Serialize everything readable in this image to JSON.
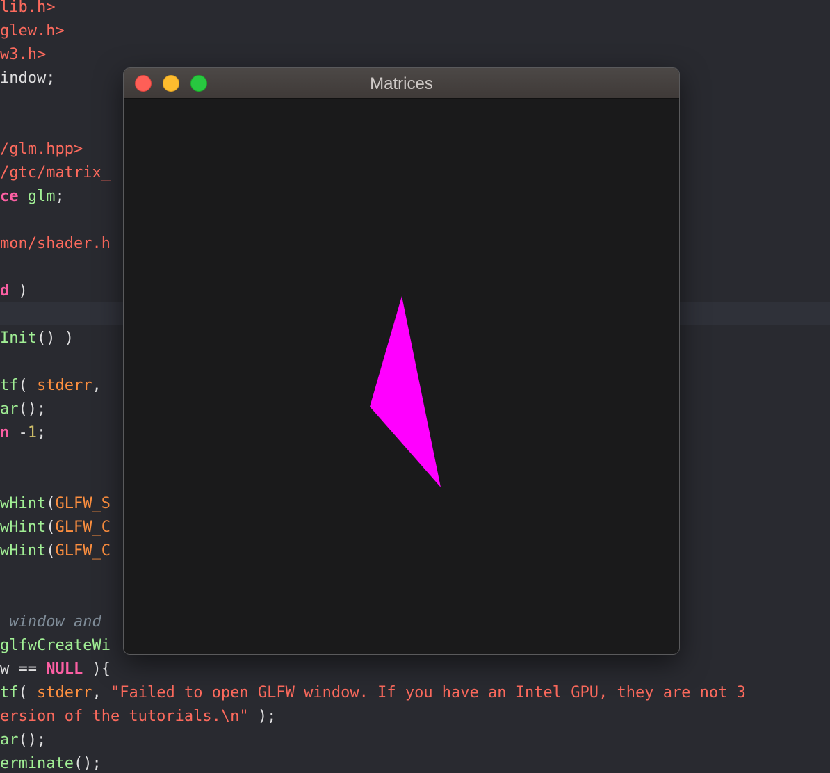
{
  "window": {
    "title": "Matrices"
  },
  "scene": {
    "background": "#1a1a1b",
    "triangle_color": "#ff00ff"
  },
  "editor": {
    "highlight_line": 13,
    "lines": [
      [
        {
          "t": "lib.h>",
          "c": "t-str"
        }
      ],
      [
        {
          "t": "glew.h>",
          "c": "t-str"
        }
      ],
      [
        {
          "t": "w3.h>",
          "c": "t-str"
        }
      ],
      [
        {
          "t": "indow;",
          "c": "t-pln"
        }
      ],
      [],
      [],
      [
        {
          "t": "/glm.hpp>",
          "c": "t-str"
        }
      ],
      [
        {
          "t": "/gtc/matrix_",
          "c": "t-str"
        }
      ],
      [
        {
          "t": "ce",
          "c": "t-kw"
        },
        {
          "t": " ",
          "c": "t-pln"
        },
        {
          "t": "glm",
          "c": "t-fn"
        },
        {
          "t": ";",
          "c": "t-pln"
        }
      ],
      [],
      [
        {
          "t": "mon/shader.h",
          "c": "t-str"
        }
      ],
      [],
      [
        {
          "t": "d",
          "c": "t-kw"
        },
        {
          "t": " )",
          "c": "t-pln"
        }
      ],
      [],
      [
        {
          "t": "Init",
          "c": "t-fn"
        },
        {
          "t": "() )",
          "c": "t-pln"
        }
      ],
      [],
      [
        {
          "t": "tf",
          "c": "t-fn"
        },
        {
          "t": "( ",
          "c": "t-pln"
        },
        {
          "t": "stderr",
          "c": "t-arg"
        },
        {
          "t": ",",
          "c": "t-pln"
        }
      ],
      [
        {
          "t": "ar",
          "c": "t-fn"
        },
        {
          "t": "();",
          "c": "t-pln"
        }
      ],
      [
        {
          "t": "n",
          "c": "t-kw"
        },
        {
          "t": " -",
          "c": "t-pln"
        },
        {
          "t": "1",
          "c": "t-num"
        },
        {
          "t": ";",
          "c": "t-pln"
        }
      ],
      [],
      [],
      [
        {
          "t": "wHint",
          "c": "t-fn"
        },
        {
          "t": "(",
          "c": "t-pln"
        },
        {
          "t": "GLFW_S",
          "c": "t-mac"
        }
      ],
      [
        {
          "t": "wHint",
          "c": "t-fn"
        },
        {
          "t": "(",
          "c": "t-pln"
        },
        {
          "t": "GLFW_C",
          "c": "t-mac"
        }
      ],
      [
        {
          "t": "wHint",
          "c": "t-fn"
        },
        {
          "t": "(",
          "c": "t-pln"
        },
        {
          "t": "GLFW_C",
          "c": "t-mac"
        }
      ],
      [],
      [],
      [
        {
          "t": " window and",
          "c": "t-cmt"
        }
      ],
      [
        {
          "t": "glfwCreateWi",
          "c": "t-fn"
        }
      ],
      [
        {
          "t": "w",
          "c": "t-pln"
        },
        {
          "t": " == ",
          "c": "t-pln"
        },
        {
          "t": "NULL",
          "c": "t-kw"
        },
        {
          "t": " ){",
          "c": "t-pln"
        }
      ],
      [
        {
          "t": "tf",
          "c": "t-fn"
        },
        {
          "t": "( ",
          "c": "t-pln"
        },
        {
          "t": "stderr",
          "c": "t-arg"
        },
        {
          "t": ", ",
          "c": "t-pln"
        },
        {
          "t": "\"Failed to open GLFW window. If you have an Intel GPU, they are not 3",
          "c": "t-str"
        }
      ],
      [
        {
          "t": "ersion of the tutorials.\\n\"",
          "c": "t-str"
        },
        {
          "t": " );",
          "c": "t-pln"
        }
      ],
      [
        {
          "t": "ar",
          "c": "t-fn"
        },
        {
          "t": "();",
          "c": "t-pln"
        }
      ],
      [
        {
          "t": "erminate",
          "c": "t-fn"
        },
        {
          "t": "();",
          "c": "t-pln"
        }
      ]
    ]
  }
}
